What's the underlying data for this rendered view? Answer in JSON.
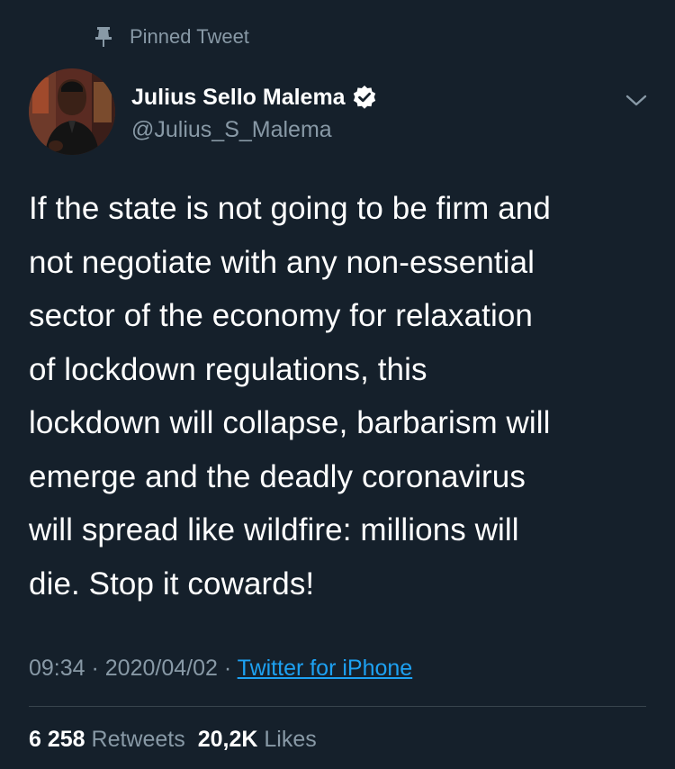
{
  "pinned": {
    "label": "Pinned Tweet",
    "icon": "pin-icon"
  },
  "author": {
    "name": "Julius Sello Malema",
    "handle": "@Julius_S_Malema",
    "verified_icon": "verified-badge-icon",
    "avatar": "profile-photo-avatar"
  },
  "tweet": {
    "lines": [
      "If the state is not going to be firm and",
      "not negotiate with any non-essential",
      "sector of the economy for relaxation",
      "of lockdown regulations, this",
      "lockdown will collapse, barbarism will",
      "emerge and the deadly coronavirus",
      "will spread like wildfire: millions will",
      "die. Stop it cowards!"
    ]
  },
  "meta": {
    "time": "09:34",
    "separator": " · ",
    "date": "2020/04/02",
    "source": "Twitter for iPhone"
  },
  "stats": {
    "retweets_count": "6 258",
    "retweets_label": "Retweets",
    "likes_count": "20,2K",
    "likes_label": "Likes"
  },
  "colors": {
    "background": "#15202b",
    "text": "#ffffff",
    "secondary": "#8899a6",
    "accent": "#1da1f2",
    "divider": "#38444d"
  },
  "menu_icon": "chevron-down-icon"
}
